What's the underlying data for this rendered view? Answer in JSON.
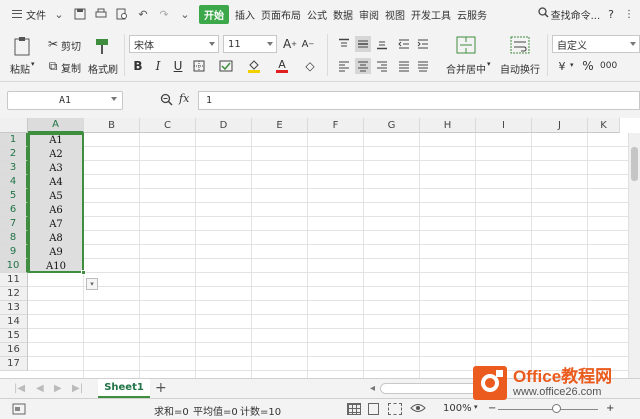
{
  "menu": {
    "file": "文件",
    "tabs": [
      "开始",
      "插入",
      "页面布局",
      "公式",
      "数据",
      "审阅",
      "视图",
      "开发工具",
      "云服务"
    ],
    "active_tab": "开始",
    "search_label": "查找命令...",
    "help": "?",
    "more": "⋮"
  },
  "ribbon": {
    "cut": "剪切",
    "copy": "复制",
    "paste": "粘贴",
    "format_painter": "格式刷",
    "font_name": "宋体",
    "font_size": "11",
    "bold": "B",
    "italic": "I",
    "underline": "U",
    "merge_center": "合并居中",
    "wrap_text": "自动换行",
    "number_format": "自定义",
    "percent": "%",
    "thousands": "000"
  },
  "formula_bar": {
    "name_box": "A1",
    "fx": "fx",
    "formula": "1"
  },
  "grid": {
    "columns": [
      "A",
      "B",
      "C",
      "D",
      "E",
      "F",
      "G",
      "H",
      "I",
      "J",
      "K"
    ],
    "rows": [
      "1",
      "2",
      "3",
      "4",
      "5",
      "6",
      "7",
      "8",
      "9",
      "10",
      "11",
      "12",
      "13",
      "14",
      "15",
      "16",
      "17"
    ],
    "column_a_values": [
      "A1",
      "A2",
      "A3",
      "A4",
      "A5",
      "A6",
      "A7",
      "A8",
      "A9",
      "A10"
    ],
    "selected_range": "A1:A10"
  },
  "sheets": {
    "active": "Sheet1",
    "add": "+"
  },
  "status": {
    "sum": "求和=0",
    "average": "平均值=0",
    "count": "计数=10",
    "zoom": "100%",
    "zoom_minus": "−",
    "zoom_plus": "+"
  },
  "watermark": {
    "title": "Office教程网",
    "url": "www.office26.com"
  },
  "colors": {
    "accent_green": "#3ca84a",
    "selection_border": "#3f8e3f",
    "watermark_orange": "#ea5b1d"
  }
}
